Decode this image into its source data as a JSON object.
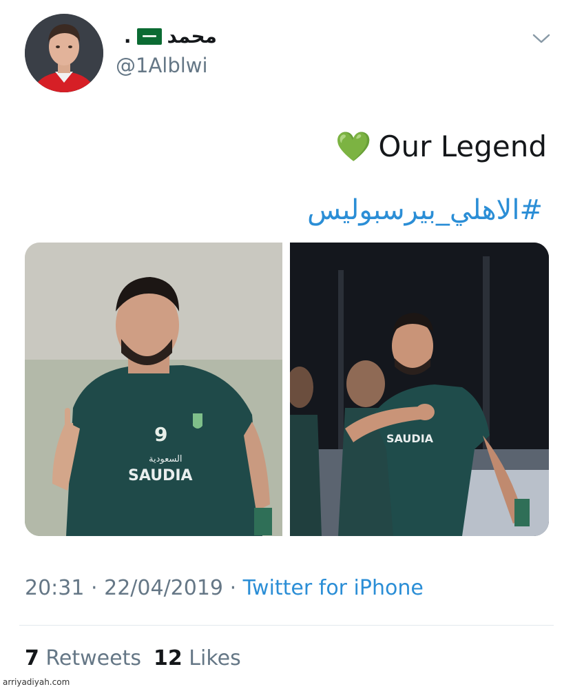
{
  "tweet": {
    "author": {
      "display_name": "محمد",
      "display_suffix": ".",
      "flag_icon": "saudi-flag-icon",
      "handle": "@1Alblwi",
      "avatar_icon": "avatar-photo"
    },
    "menu_icon": "chevron-down-icon",
    "text": {
      "heart_emoji": "💚",
      "line1": "Our Legend",
      "hashtag": "#الاهلي_بيرسبوليس"
    },
    "media": [
      {
        "name": "photo-player-celebrating",
        "jersey_number": "9",
        "sponsor": "SAUDIA",
        "sponsor_ar": "السعودية"
      },
      {
        "name": "photo-player-fist-pump",
        "sponsor": "SAUDIA"
      }
    ],
    "meta": {
      "time": "20:31",
      "separator": "·",
      "date": "22/04/2019",
      "source": "Twitter for iPhone"
    },
    "stats": {
      "retweets_count": "7",
      "retweets_label": "Retweets",
      "likes_count": "12",
      "likes_label": "Likes"
    }
  },
  "watermark": "arriyadiyah.com",
  "colors": {
    "link": "#2b8ed6",
    "secondary_text": "#657786",
    "heart": "#22b14c",
    "divider": "#e1e8ed"
  }
}
